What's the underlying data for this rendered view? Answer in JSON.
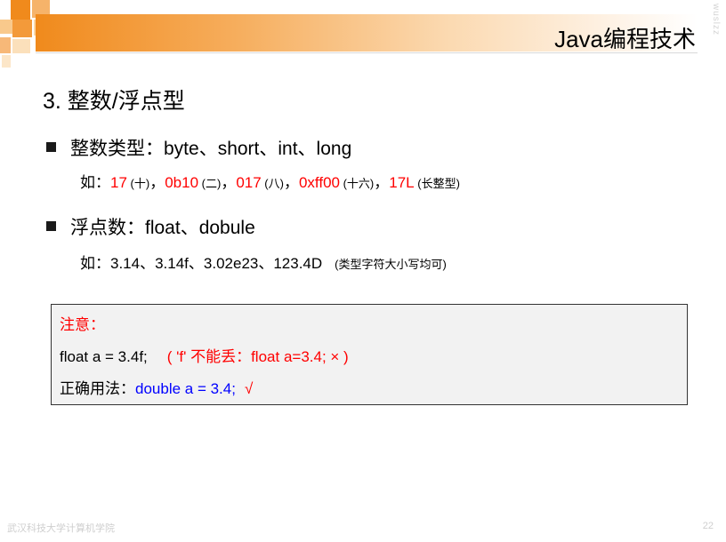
{
  "header": {
    "title": "Java编程技术",
    "watermark": "wuslzz"
  },
  "section_heading": "3.  整数/浮点型",
  "integer": {
    "label": "整数类型：byte、short、int、long",
    "prefix": "如：",
    "ex1": "17",
    "ex1_note": " (十)",
    "sep1": "，",
    "ex2": "0b10",
    "ex2_note": " (二)",
    "sep2": "，",
    "ex3": "017",
    "ex3_note": " (八)",
    "sep3": "，",
    "ex4": "0xff00",
    "ex4_note": " (十六)",
    "sep4": "，",
    "ex5": "17L",
    "ex5_note": " (长整型)"
  },
  "float": {
    "label": "浮点数：float、dobule",
    "example": "如：3.14、3.14f、3.02e23、123.4D",
    "note": "(类型字符大小写均可)"
  },
  "note": {
    "title": "注意：",
    "line1_code": "float a = 3.4f;",
    "line1_warn": "( 'f' 不能丢：float a=3.4;  ×  )",
    "line2_label": "正确用法：",
    "line2_code": "double a = 3.4;",
    "line2_check": "√"
  },
  "footer": {
    "institution": "武汉科技大学计算机学院",
    "page_number": "22"
  },
  "colors": {
    "accent_orange": "#f08a1c",
    "highlight_red": "#ff0000",
    "code_blue": "#0000ff"
  }
}
